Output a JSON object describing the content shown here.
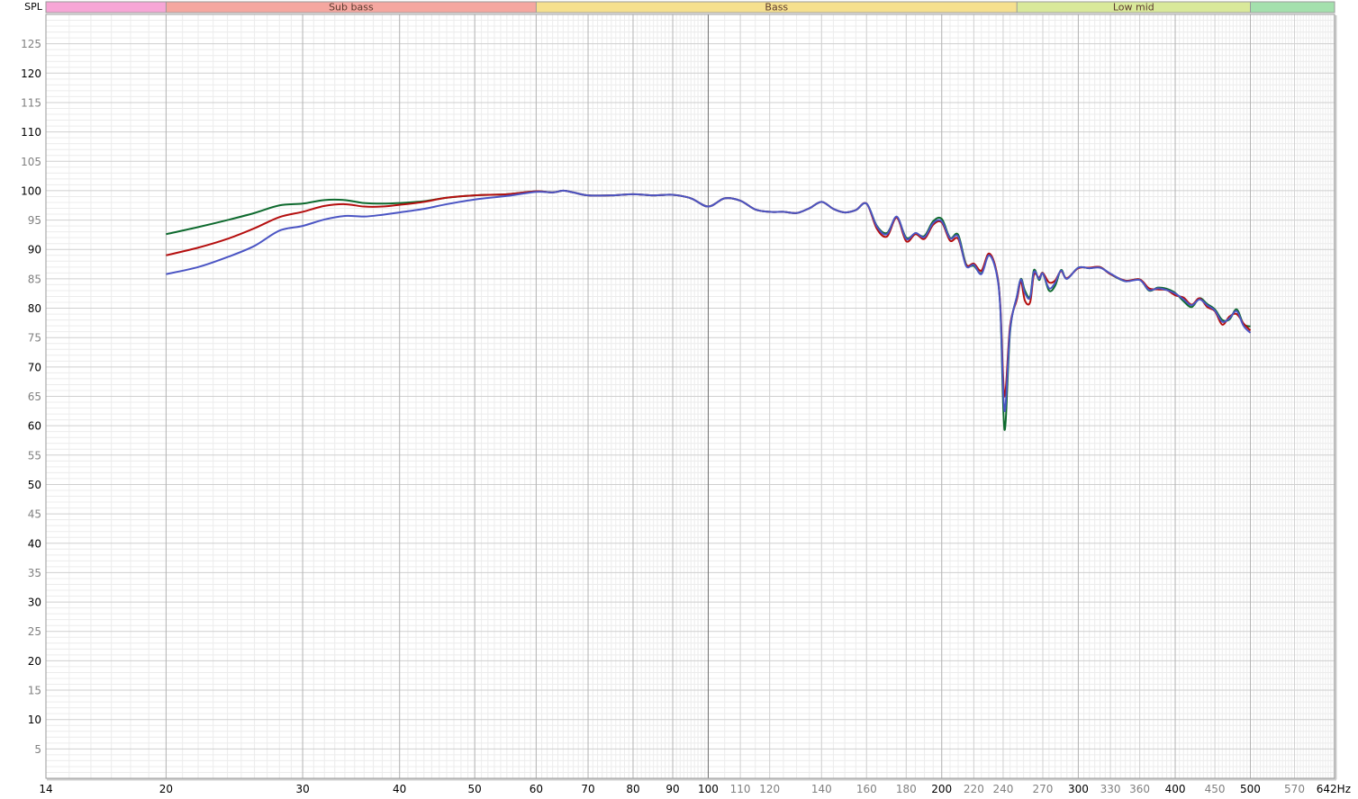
{
  "chart_data": {
    "type": "line",
    "ylabel": "SPL",
    "xunit": "Hz",
    "xscale": "log",
    "xlim": [
      14,
      642
    ],
    "ylim": [
      0,
      130
    ],
    "grid": true,
    "bands": [
      {
        "label": "",
        "start": 14,
        "end": 20,
        "color": "#f7a6d6"
      },
      {
        "label": "Sub bass",
        "start": 20,
        "end": 60,
        "color": "#f5a7a0"
      },
      {
        "label": "Bass",
        "start": 60,
        "end": 250,
        "color": "#f6e08e"
      },
      {
        "label": "Low mid",
        "start": 250,
        "end": 500,
        "color": "#d9e99a"
      },
      {
        "label": "",
        "start": 500,
        "end": 642,
        "color": "#a4e0ad"
      }
    ],
    "x_ticks": [
      {
        "v": 14,
        "label": "14"
      },
      {
        "v": 20,
        "label": "20"
      },
      {
        "v": 30,
        "label": "30"
      },
      {
        "v": 40,
        "label": "40"
      },
      {
        "v": 50,
        "label": "50"
      },
      {
        "v": 60,
        "label": "60"
      },
      {
        "v": 70,
        "label": "70"
      },
      {
        "v": 80,
        "label": "80"
      },
      {
        "v": 90,
        "label": "90"
      },
      {
        "v": 100,
        "label": "100"
      },
      {
        "v": 110,
        "label": "110"
      },
      {
        "v": 120,
        "label": "120"
      },
      {
        "v": 140,
        "label": "140"
      },
      {
        "v": 160,
        "label": "160"
      },
      {
        "v": 180,
        "label": "180"
      },
      {
        "v": 200,
        "label": "200"
      },
      {
        "v": 220,
        "label": "220"
      },
      {
        "v": 240,
        "label": "240"
      },
      {
        "v": 270,
        "label": "270"
      },
      {
        "v": 300,
        "label": "300"
      },
      {
        "v": 330,
        "label": "330"
      },
      {
        "v": 360,
        "label": "360"
      },
      {
        "v": 400,
        "label": "400"
      },
      {
        "v": 450,
        "label": "450"
      },
      {
        "v": 500,
        "label": "500"
      },
      {
        "v": 570,
        "label": "570"
      },
      {
        "v": 642,
        "label": "642Hz"
      }
    ],
    "x_major": [
      20,
      30,
      40,
      50,
      60,
      70,
      80,
      90,
      100,
      200,
      300,
      400,
      500
    ],
    "y_ticks": [
      {
        "v": 125,
        "label": "125"
      },
      {
        "v": 120,
        "label": "120"
      },
      {
        "v": 115,
        "label": "115"
      },
      {
        "v": 110,
        "label": "110"
      },
      {
        "v": 105,
        "label": "105"
      },
      {
        "v": 100,
        "label": "100"
      },
      {
        "v": 95,
        "label": "95"
      },
      {
        "v": 90,
        "label": "90"
      },
      {
        "v": 85,
        "label": "85"
      },
      {
        "v": 80,
        "label": "80"
      },
      {
        "v": 75,
        "label": "75"
      },
      {
        "v": 70,
        "label": "70"
      },
      {
        "v": 65,
        "label": "65"
      },
      {
        "v": 60,
        "label": "60"
      },
      {
        "v": 55,
        "label": "55"
      },
      {
        "v": 50,
        "label": "50"
      },
      {
        "v": 45,
        "label": "45"
      },
      {
        "v": 40,
        "label": "40"
      },
      {
        "v": 35,
        "label": "35"
      },
      {
        "v": 30,
        "label": "30"
      },
      {
        "v": 25,
        "label": "25"
      },
      {
        "v": 20,
        "label": "20"
      },
      {
        "v": 15,
        "label": "15"
      },
      {
        "v": 10,
        "label": "10"
      },
      {
        "v": 5,
        "label": "5"
      }
    ],
    "series": [
      {
        "color": "#0e6a2e",
        "points": [
          [
            20,
            92.6
          ],
          [
            22,
            93.8
          ],
          [
            24,
            95
          ],
          [
            26,
            96.2
          ],
          [
            28,
            97.5
          ],
          [
            30,
            97.8
          ],
          [
            32,
            98.4
          ],
          [
            34,
            98.4
          ],
          [
            36,
            97.9
          ],
          [
            38,
            97.8
          ],
          [
            40,
            97.9
          ],
          [
            43,
            98.2
          ],
          [
            46,
            98.8
          ],
          [
            50,
            99.2
          ],
          [
            55,
            99.4
          ],
          [
            60,
            99.9
          ],
          [
            63,
            99.7
          ],
          [
            65,
            100
          ],
          [
            67,
            99.7
          ],
          [
            70,
            99.2
          ],
          [
            75,
            99.2
          ],
          [
            80,
            99.4
          ],
          [
            85,
            99.2
          ],
          [
            90,
            99.3
          ],
          [
            95,
            98.7
          ],
          [
            100,
            97.3
          ],
          [
            105,
            98.7
          ],
          [
            110,
            98.3
          ],
          [
            115,
            96.8
          ],
          [
            120,
            96.4
          ],
          [
            125,
            96.4
          ],
          [
            130,
            96.2
          ],
          [
            135,
            97
          ],
          [
            140,
            98.1
          ],
          [
            145,
            96.9
          ],
          [
            150,
            96.3
          ],
          [
            155,
            96.7
          ],
          [
            160,
            97.8
          ],
          [
            165,
            94
          ],
          [
            170,
            92.8
          ],
          [
            175,
            95.5
          ],
          [
            180,
            92
          ],
          [
            185,
            92.7
          ],
          [
            190,
            92.3
          ],
          [
            195,
            94.8
          ],
          [
            200,
            95.2
          ],
          [
            205,
            92
          ],
          [
            210,
            92.5
          ],
          [
            215,
            87.5
          ],
          [
            220,
            87.2
          ],
          [
            225,
            86
          ],
          [
            230,
            89
          ],
          [
            235,
            86.5
          ],
          [
            238,
            80
          ],
          [
            241,
            59.3
          ],
          [
            245,
            76
          ],
          [
            250,
            82
          ],
          [
            253,
            85
          ],
          [
            256,
            83
          ],
          [
            260,
            82
          ],
          [
            263,
            86.5
          ],
          [
            267,
            84.8
          ],
          [
            270,
            86
          ],
          [
            275,
            83
          ],
          [
            280,
            83.8
          ],
          [
            285,
            86.5
          ],
          [
            290,
            85
          ],
          [
            300,
            86.9
          ],
          [
            310,
            86.8
          ],
          [
            320,
            87
          ],
          [
            330,
            85.8
          ],
          [
            345,
            84.6
          ],
          [
            360,
            84.9
          ],
          [
            370,
            83
          ],
          [
            380,
            83.5
          ],
          [
            390,
            83.3
          ],
          [
            400,
            82.6
          ],
          [
            410,
            81.2
          ],
          [
            420,
            80.2
          ],
          [
            430,
            81.7
          ],
          [
            440,
            80.7
          ],
          [
            450,
            79.8
          ],
          [
            460,
            78
          ],
          [
            470,
            78.1
          ],
          [
            480,
            79.8
          ],
          [
            490,
            77.3
          ],
          [
            500,
            76.9
          ]
        ]
      },
      {
        "color": "#b50e0e",
        "points": [
          [
            20,
            89
          ],
          [
            22,
            90.3
          ],
          [
            24,
            91.8
          ],
          [
            26,
            93.6
          ],
          [
            28,
            95.5
          ],
          [
            30,
            96.4
          ],
          [
            32,
            97.4
          ],
          [
            34,
            97.7
          ],
          [
            36,
            97.3
          ],
          [
            38,
            97.3
          ],
          [
            40,
            97.6
          ],
          [
            43,
            98.1
          ],
          [
            46,
            98.8
          ],
          [
            50,
            99.2
          ],
          [
            55,
            99.4
          ],
          [
            60,
            99.9
          ],
          [
            63,
            99.7
          ],
          [
            65,
            100
          ],
          [
            67,
            99.7
          ],
          [
            70,
            99.2
          ],
          [
            75,
            99.2
          ],
          [
            80,
            99.4
          ],
          [
            85,
            99.2
          ],
          [
            90,
            99.3
          ],
          [
            95,
            98.7
          ],
          [
            100,
            97.3
          ],
          [
            105,
            98.7
          ],
          [
            110,
            98.3
          ],
          [
            115,
            96.8
          ],
          [
            120,
            96.4
          ],
          [
            125,
            96.4
          ],
          [
            130,
            96.2
          ],
          [
            135,
            97
          ],
          [
            140,
            98.1
          ],
          [
            145,
            96.9
          ],
          [
            150,
            96.3
          ],
          [
            155,
            96.7
          ],
          [
            160,
            97.8
          ],
          [
            165,
            93.5
          ],
          [
            170,
            92.2
          ],
          [
            175,
            95.4
          ],
          [
            180,
            91.4
          ],
          [
            185,
            92.6
          ],
          [
            190,
            91.8
          ],
          [
            195,
            94.2
          ],
          [
            200,
            94.6
          ],
          [
            205,
            91.5
          ],
          [
            210,
            91.8
          ],
          [
            215,
            87.4
          ],
          [
            220,
            87.6
          ],
          [
            225,
            86.4
          ],
          [
            230,
            89.3
          ],
          [
            235,
            86.6
          ],
          [
            238,
            80.5
          ],
          [
            241,
            65
          ],
          [
            245,
            77
          ],
          [
            250,
            81.5
          ],
          [
            253,
            84.5
          ],
          [
            256,
            81.3
          ],
          [
            260,
            81
          ],
          [
            263,
            85.7
          ],
          [
            267,
            85.2
          ],
          [
            270,
            86
          ],
          [
            275,
            84.4
          ],
          [
            280,
            84.7
          ],
          [
            285,
            86.3
          ],
          [
            290,
            85.1
          ],
          [
            300,
            86.8
          ],
          [
            310,
            86.9
          ],
          [
            320,
            87
          ],
          [
            330,
            85.8
          ],
          [
            345,
            84.7
          ],
          [
            360,
            84.9
          ],
          [
            370,
            83.4
          ],
          [
            380,
            83.2
          ],
          [
            390,
            83.1
          ],
          [
            400,
            82.2
          ],
          [
            410,
            81.8
          ],
          [
            420,
            80.6
          ],
          [
            430,
            81.7
          ],
          [
            440,
            80.2
          ],
          [
            450,
            79.5
          ],
          [
            460,
            77.2
          ],
          [
            470,
            78.6
          ],
          [
            480,
            79
          ],
          [
            490,
            77.4
          ],
          [
            500,
            76.2
          ]
        ]
      },
      {
        "color": "#4b55c4",
        "points": [
          [
            20,
            85.8
          ],
          [
            22,
            87
          ],
          [
            24,
            88.7
          ],
          [
            26,
            90.6
          ],
          [
            28,
            93.2
          ],
          [
            30,
            94
          ],
          [
            32,
            95.1
          ],
          [
            34,
            95.7
          ],
          [
            36,
            95.6
          ],
          [
            38,
            95.9
          ],
          [
            40,
            96.3
          ],
          [
            43,
            96.9
          ],
          [
            46,
            97.7
          ],
          [
            50,
            98.5
          ],
          [
            55,
            99.1
          ],
          [
            60,
            99.8
          ],
          [
            63,
            99.7
          ],
          [
            65,
            100
          ],
          [
            67,
            99.7
          ],
          [
            70,
            99.2
          ],
          [
            75,
            99.2
          ],
          [
            80,
            99.4
          ],
          [
            85,
            99.2
          ],
          [
            90,
            99.3
          ],
          [
            95,
            98.7
          ],
          [
            100,
            97.3
          ],
          [
            105,
            98.7
          ],
          [
            110,
            98.3
          ],
          [
            115,
            96.8
          ],
          [
            120,
            96.4
          ],
          [
            125,
            96.4
          ],
          [
            130,
            96.2
          ],
          [
            135,
            97
          ],
          [
            140,
            98.1
          ],
          [
            145,
            96.9
          ],
          [
            150,
            96.3
          ],
          [
            155,
            96.7
          ],
          [
            160,
            97.8
          ],
          [
            165,
            93.9
          ],
          [
            170,
            92.6
          ],
          [
            175,
            95.6
          ],
          [
            180,
            91.8
          ],
          [
            185,
            92.8
          ],
          [
            190,
            92.1
          ],
          [
            195,
            94.5
          ],
          [
            200,
            94.8
          ],
          [
            205,
            91.9
          ],
          [
            210,
            92.2
          ],
          [
            215,
            87.2
          ],
          [
            220,
            87.4
          ],
          [
            225,
            85.8
          ],
          [
            230,
            89
          ],
          [
            235,
            86.3
          ],
          [
            238,
            80
          ],
          [
            241,
            62.5
          ],
          [
            245,
            76.4
          ],
          [
            250,
            82
          ],
          [
            253,
            84.9
          ],
          [
            256,
            82.6
          ],
          [
            260,
            81.8
          ],
          [
            263,
            86.2
          ],
          [
            267,
            85
          ],
          [
            270,
            85.9
          ],
          [
            275,
            83.4
          ],
          [
            280,
            84.3
          ],
          [
            285,
            86.4
          ],
          [
            290,
            85
          ],
          [
            300,
            86.9
          ],
          [
            310,
            86.8
          ],
          [
            320,
            86.9
          ],
          [
            330,
            85.9
          ],
          [
            345,
            84.6
          ],
          [
            360,
            84.8
          ],
          [
            370,
            83.1
          ],
          [
            380,
            83.4
          ],
          [
            390,
            83.1
          ],
          [
            400,
            82.5
          ],
          [
            410,
            81.5
          ],
          [
            420,
            80.5
          ],
          [
            430,
            81.5
          ],
          [
            440,
            80.5
          ],
          [
            450,
            79.6
          ],
          [
            460,
            77.7
          ],
          [
            470,
            78.3
          ],
          [
            480,
            79.5
          ],
          [
            490,
            77
          ],
          [
            500,
            75.8
          ]
        ]
      }
    ]
  }
}
